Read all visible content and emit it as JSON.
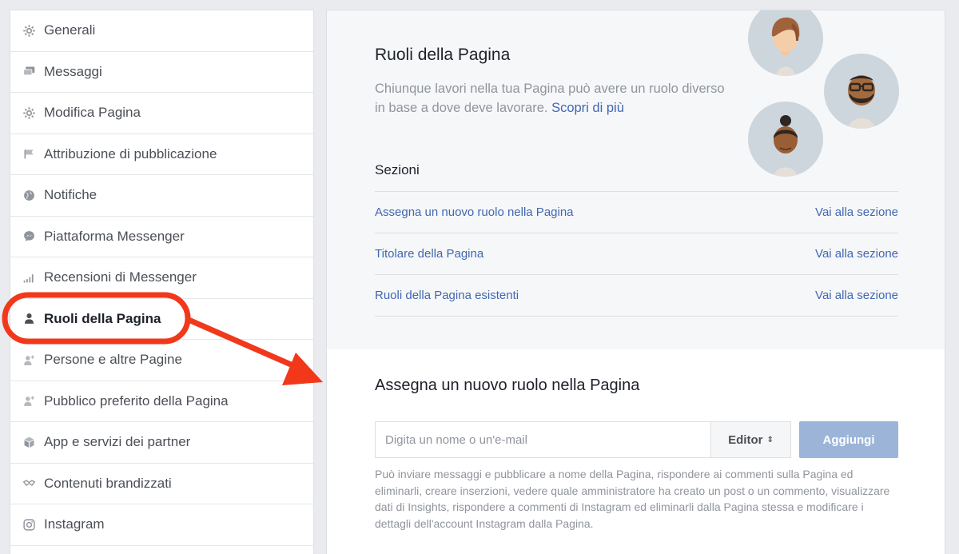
{
  "sidebar": {
    "items": [
      {
        "label": "Generali",
        "icon": "gear-icon"
      },
      {
        "label": "Messaggi",
        "icon": "messages-icon"
      },
      {
        "label": "Modifica Pagina",
        "icon": "gear-icon"
      },
      {
        "label": "Attribuzione di pubblicazione",
        "icon": "flag-icon"
      },
      {
        "label": "Notifiche",
        "icon": "globe-icon"
      },
      {
        "label": "Piattaforma Messenger",
        "icon": "messenger-icon"
      },
      {
        "label": "Recensioni di Messenger",
        "icon": "signal-bars-icon"
      },
      {
        "label": "Ruoli della Pagina",
        "icon": "person-icon",
        "active": true
      },
      {
        "label": "Persone e altre Pagine",
        "icon": "person-add-icon"
      },
      {
        "label": "Pubblico preferito della Pagina",
        "icon": "person-add-icon"
      },
      {
        "label": "App e servizi dei partner",
        "icon": "cube-icon"
      },
      {
        "label": "Contenuti brandizzati",
        "icon": "handshake-icon"
      },
      {
        "label": "Instagram",
        "icon": "instagram-icon"
      }
    ]
  },
  "roles": {
    "title": "Ruoli della Pagina",
    "description": "Chiunque lavori nella tua Pagina può avere un ruolo diverso in base a dove deve lavorare.",
    "learn_more": "Scopri di più",
    "sections_label": "Sezioni",
    "sections": [
      {
        "label": "Assegna un nuovo ruolo nella Pagina",
        "action": "Vai alla sezione"
      },
      {
        "label": "Titolare della Pagina",
        "action": "Vai alla sezione"
      },
      {
        "label": "Ruoli della Pagina esistenti",
        "action": "Vai alla sezione"
      }
    ]
  },
  "assign": {
    "title": "Assegna un nuovo ruolo nella Pagina",
    "input_placeholder": "Digita un nome o un'e-mail",
    "input_value": "",
    "role_selected": "Editor",
    "add_label": "Aggiungi",
    "help_text": "Può inviare messaggi e pubblicare a nome della Pagina, rispondere ai commenti sulla Pagina ed eliminarli, creare inserzioni, vedere quale amministratore ha creato un post o un commento, visualizzare dati di Insights, rispondere a commenti di Instagram ed eliminarli dalla Pagina stessa e modificare i dettagli dell'account Instagram dalla Pagina."
  },
  "colors": {
    "accent": "#4267b2",
    "annotation": "#f2381b",
    "add_button": "#9cb4d8"
  }
}
